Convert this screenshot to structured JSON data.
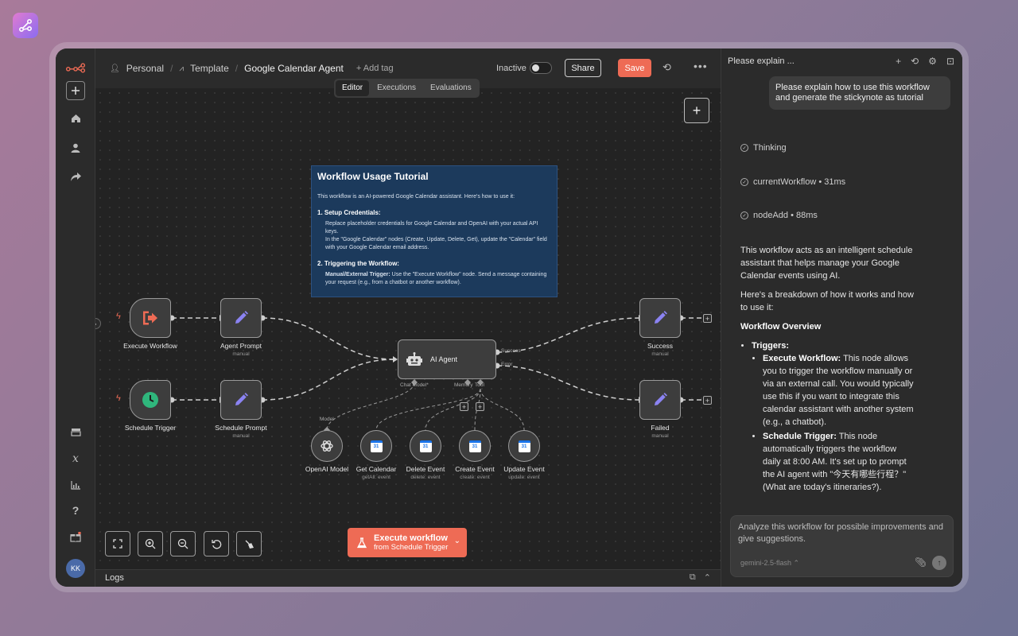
{
  "header": {
    "breadcrumb_personal": "Personal",
    "breadcrumb_template": "Template",
    "workflow_title": "Google Calendar Agent",
    "add_tag": "+ Add tag",
    "status_label": "Inactive",
    "share_label": "Share",
    "save_label": "Save"
  },
  "tabs": [
    {
      "label": "Editor",
      "active": true
    },
    {
      "label": "Executions",
      "active": false
    },
    {
      "label": "Evaluations",
      "active": false
    }
  ],
  "sticky": {
    "title": "Workflow Usage Tutorial",
    "intro": "This workflow is an AI-powered Google Calendar assistant. Here's how to use it:",
    "s1_head": "1. Setup Credentials:",
    "s1_l1": "Replace placeholder credentials for Google Calendar and OpenAI with your actual API keys.",
    "s1_l2": "In the \"Google Calendar\" nodes (Create, Update, Delete, Get), update the \"Calendar\" field with your Google Calendar email address.",
    "s2_head": "2. Triggering the Workflow:",
    "s2_bold": "Manual/External Trigger:",
    "s2_l1": " Use the \"Execute Workflow\" node. Send a message containing your request (e.g., from a chatbot or another workflow)."
  },
  "nodes": {
    "execute_workflow": "Execute Workflow",
    "agent_prompt": "Agent Prompt",
    "agent_prompt_sub": "manual",
    "schedule_trigger": "Schedule Trigger",
    "schedule_prompt": "Schedule Prompt",
    "schedule_prompt_sub": "manual",
    "ai_agent": "AI Agent",
    "success": "Success",
    "success_sub": "manual",
    "failed": "Failed",
    "failed_sub": "manual",
    "port_success": "Success",
    "port_error": "Error",
    "port_chat_model": "Chat Model*",
    "port_memory": "Memory",
    "port_tool": "Tool",
    "port_model": "Model",
    "openai_model": "OpenAI Model",
    "get_calendar": "Get Calendar",
    "get_calendar_sub": "getAll: event",
    "delete_event": "Delete Event",
    "delete_event_sub": "delete: event",
    "create_event": "Create Event",
    "create_event_sub": "create: event",
    "update_event": "Update Event",
    "update_event_sub": "update: event"
  },
  "execute_button": {
    "line1": "Execute workflow",
    "line2": "from Schedule Trigger"
  },
  "logs": {
    "label": "Logs"
  },
  "sidebar": {
    "avatar_initials": "KK"
  },
  "panel": {
    "title": "Please explain ...",
    "user_message": "Please explain how to use this workflow and generate the stickynote as tutorial",
    "steps": [
      {
        "label": "Thinking"
      },
      {
        "label": "currentWorkflow • 31ms"
      },
      {
        "label": "nodeAdd • 88ms"
      }
    ],
    "answer": {
      "p1": "This workflow acts as an intelligent schedule assistant that helps manage your Google Calendar events using AI.",
      "p2": "Here's a breakdown of how it works and how to use it:",
      "h1": "Workflow Overview",
      "triggers": "Triggers:",
      "t1_bold": "Execute Workflow:",
      "t1_text": " This node allows you to trigger the workflow manually or via an external call. You would typically use this if you want to integrate this calendar assistant with another system (e.g., a chatbot).",
      "t2_bold": "Schedule Trigger:",
      "t2_text": " This node automatically triggers the workflow daily at 8:00 AM. It's set up to prompt the AI agent with \"今天有哪些行程？\" (What are today's itineraries?)."
    },
    "input_text": "Analyze this workflow for possible improvements and give suggestions.",
    "model": "gemini-2.5-flash"
  },
  "colors": {
    "accent": "#ee6b55",
    "sticky_bg": "#1c3a5c",
    "canvas_bg": "#232323"
  }
}
